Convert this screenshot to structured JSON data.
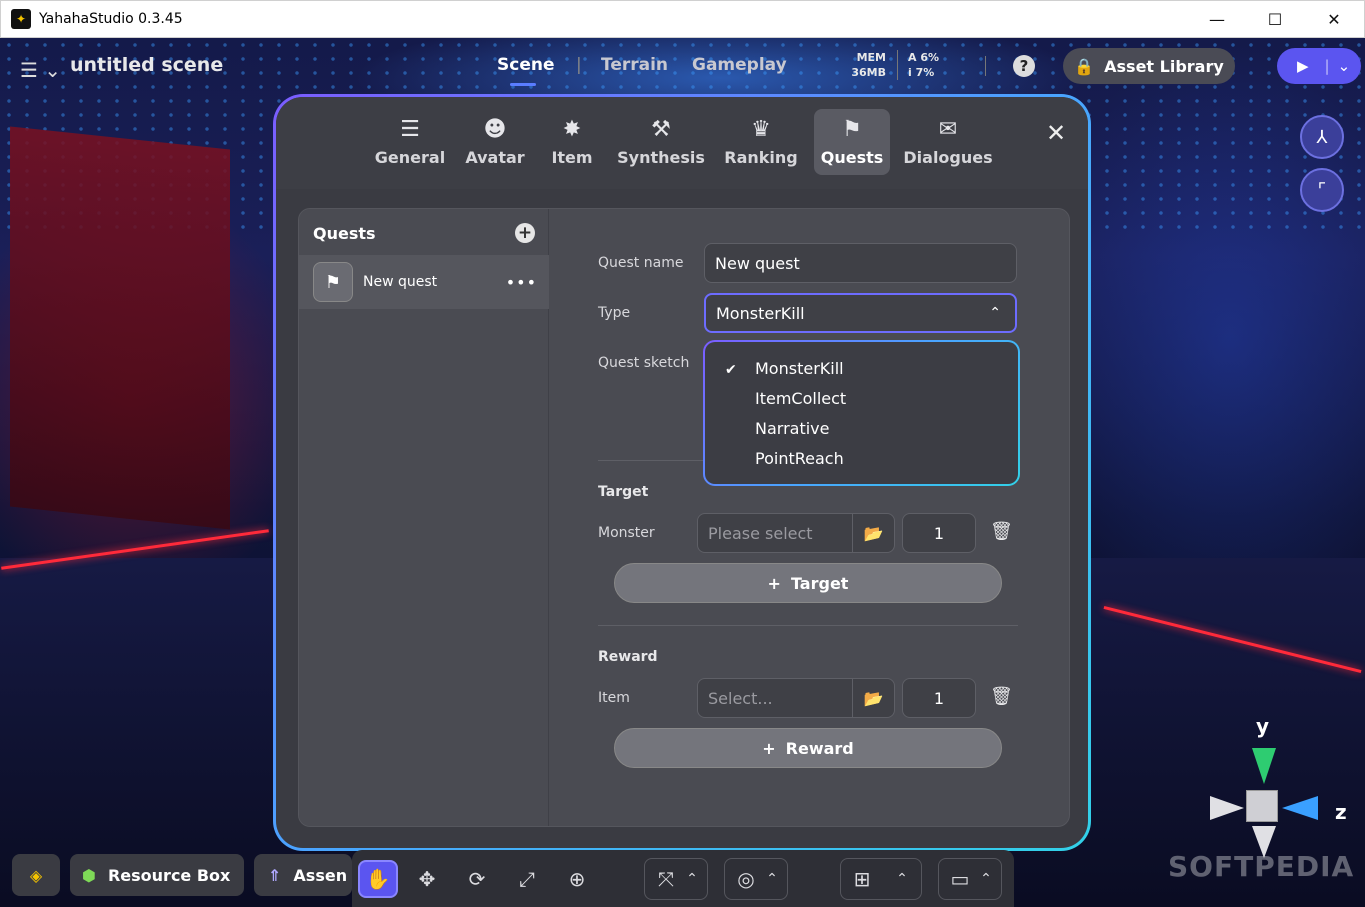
{
  "window": {
    "title": "YahahaStudio 0.3.45",
    "minimize": "—",
    "maximize": "☐",
    "close": "✕"
  },
  "header": {
    "scene_title": "untitled scene",
    "nav": [
      "Scene",
      "Terrain",
      "Gameplay"
    ],
    "active_nav": "Scene",
    "mem_label": "MEM",
    "mem_value": "36MB",
    "stat_a": "A",
    "stat_a_value": "6%",
    "stat_i": "i",
    "stat_i_value": "7%",
    "asset_library": "Asset Library"
  },
  "modal": {
    "tabs": [
      {
        "label": "General",
        "icon": "sliders-icon"
      },
      {
        "label": "Avatar",
        "icon": "avatar-icon"
      },
      {
        "label": "Item",
        "icon": "item-icon"
      },
      {
        "label": "Synthesis",
        "icon": "hammer-icon"
      },
      {
        "label": "Ranking",
        "icon": "trophy-icon"
      },
      {
        "label": "Quests",
        "icon": "flag-icon"
      },
      {
        "label": "Dialogues",
        "icon": "chat-icon"
      }
    ],
    "active_tab": "Quests"
  },
  "quests_list": {
    "header": "Quests",
    "items": [
      {
        "name": "New quest"
      }
    ]
  },
  "form": {
    "quest_name_label": "Quest name",
    "quest_name_value": "New quest",
    "type_label": "Type",
    "type_value": "MonsterKill",
    "quest_sketch_label": "Quest sketch",
    "type_options": [
      "MonsterKill",
      "ItemCollect",
      "Narrative",
      "PointReach"
    ],
    "target_section": "Target",
    "monster_label": "Monster",
    "monster_placeholder": "Please select",
    "monster_count": "1",
    "add_target": "Target",
    "reward_section": "Reward",
    "item_label": "Item",
    "item_placeholder": "Select...",
    "item_count": "1",
    "add_reward": "Reward"
  },
  "bottom": {
    "resource_box": "Resource Box",
    "assets": "Assen"
  },
  "gizmo": {
    "y": "y",
    "z": "z"
  },
  "watermark": "SOFTPEDIA",
  "colors": {
    "accent": "#5b55f0",
    "modal_border_start": "#7b5cff",
    "modal_border_end": "#32d1e8",
    "panel": "#4a4b52"
  }
}
